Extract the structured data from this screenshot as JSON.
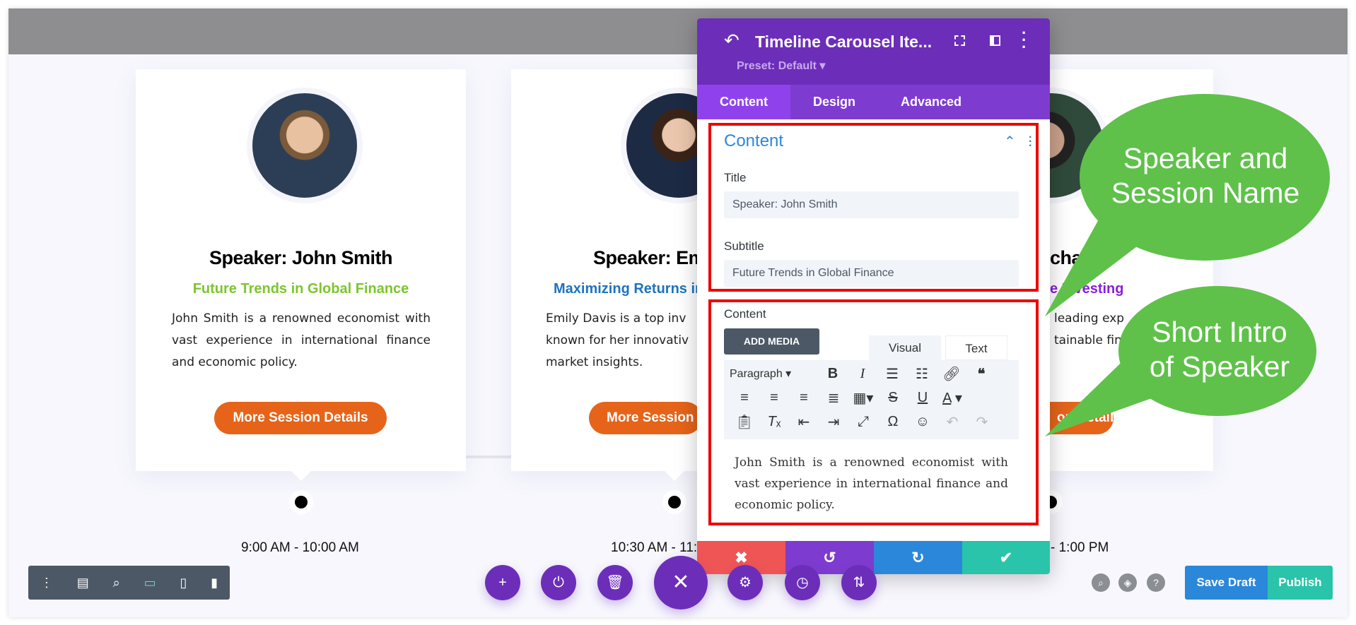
{
  "cards": [
    {
      "title": "Speaker: John Smith",
      "subtitle": "Future Trends in Global Finance",
      "subtitle_color": "#7cc62d",
      "body": "John Smith is a renowned economist with vast experience in international finance and economic policy.",
      "button": "More Session Details",
      "time": "9:00 AM - 10:00 AM"
    },
    {
      "title": "Speaker: Emi",
      "subtitle": "Maximizing Returns in a",
      "subtitle_color": "#1e73be",
      "body": "Emily Davis is a top inv known for her innovativ market insights.",
      "button": "More Session",
      "time": "10:30 AM - 11:"
    },
    {
      "title": "chael",
      "subtitle": "e Investing",
      "subtitle_color": "#8b1ed8",
      "body_lines": [
        "leading exp",
        "tainable fin"
      ],
      "button": "on Details",
      "time": "- 1:00 PM"
    }
  ],
  "panel": {
    "title": "Timeline Carousel Ite...",
    "preset": "Preset: Default ▾",
    "tabs": [
      "Content",
      "Design",
      "Advanced"
    ],
    "section_title": "Content",
    "title_label": "Title",
    "title_value": "Speaker: John Smith",
    "subtitle_label": "Subtitle",
    "subtitle_value": "Future Trends in Global Finance",
    "content_label": "Content",
    "add_media": "ADD MEDIA",
    "editor_tabs": [
      "Visual",
      "Text"
    ],
    "format_select": "Paragraph",
    "editor_text": "John Smith is a renowned economist with vast experience in international finance and economic policy."
  },
  "callouts": [
    "Speaker and Session Name",
    "Short Intro of Speaker"
  ],
  "callout_lines": [
    [
      "Speaker and",
      "Session Name"
    ],
    [
      "Short Intro",
      "of Speaker"
    ]
  ],
  "bottom": {
    "save_draft": "Save Draft",
    "publish": "Publish"
  },
  "colors": {
    "accent": "#6c2eb9",
    "button": "#e5641a",
    "callout": "#5fc14a",
    "highlight": "#e00000"
  }
}
